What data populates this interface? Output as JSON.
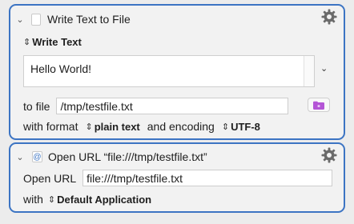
{
  "action_write": {
    "title": "Write Text to File",
    "mode_label": "Write Text",
    "text_content": "Hello World!",
    "to_file_label": "to file",
    "file_path": "/tmp/testfile.txt",
    "with_format_label": "with format",
    "format_value": "plain text",
    "and_encoding_label": "and encoding",
    "encoding_value": "UTF-8",
    "icons": [
      "doc-icon",
      "gear-icon",
      "folder-icon",
      "chevron-down-icon"
    ]
  },
  "action_open": {
    "title": "Open URL “file:///tmp/testfile.txt”",
    "open_url_label": "Open URL",
    "url_value": "file:///tmp/testfile.txt",
    "with_label": "with",
    "application_value": "Default Application",
    "icons": [
      "url-icon",
      "gear-icon",
      "chevron-down-icon"
    ]
  },
  "colors": {
    "accent": "#3c74c3",
    "folder": "#b455d6",
    "background": "#ececec",
    "panel": "#f2f2f2"
  }
}
